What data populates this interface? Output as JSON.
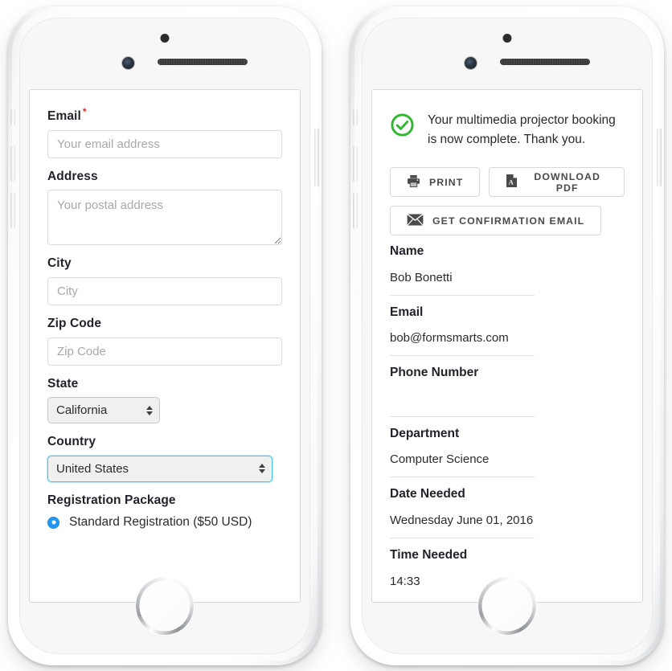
{
  "left_phone": {
    "device_label": "smartphone-mockup-left",
    "form": {
      "fields": [
        {
          "label": "Email",
          "required": true,
          "type": "text",
          "value": "",
          "placeholder": "Your email address"
        },
        {
          "label": "Address",
          "required": false,
          "type": "textarea",
          "value": "",
          "placeholder": "Your postal address"
        },
        {
          "label": "City",
          "required": false,
          "type": "text",
          "value": "",
          "placeholder": "City"
        },
        {
          "label": "Zip Code",
          "required": false,
          "type": "text",
          "value": "",
          "placeholder": "Zip Code"
        },
        {
          "label": "State",
          "required": false,
          "type": "select",
          "value": "California",
          "placeholder": ""
        },
        {
          "label": "Country",
          "required": false,
          "type": "select",
          "value": "United States",
          "placeholder": "",
          "focused": true
        }
      ],
      "radio_group": {
        "label": "Registration Package",
        "options": [
          {
            "label": "Standard Registration ($50 USD)",
            "selected": true
          }
        ]
      }
    }
  },
  "right_phone": {
    "device_label": "smartphone-mockup-right",
    "confirmation": {
      "message": "Your multimedia projector booking is now complete. Thank you.",
      "status_icon": "check-circle-icon",
      "actions": [
        {
          "label": "PRINT",
          "icon": "printer-icon"
        },
        {
          "label": "DOWNLOAD PDF",
          "icon": "pdf-file-icon"
        },
        {
          "label": "GET CONFIRMATION EMAIL",
          "icon": "envelope-icon"
        }
      ],
      "details": [
        {
          "label": "Name",
          "value": "Bob Bonetti"
        },
        {
          "label": "Email",
          "value": "bob@formsmarts.com"
        },
        {
          "label": "Phone Number",
          "value": ""
        },
        {
          "label": "Department",
          "value": "Computer Science"
        },
        {
          "label": "Date Needed",
          "value": "Wednesday June 01, 2016"
        },
        {
          "label": "Time Needed",
          "value": "14:33"
        }
      ]
    }
  },
  "colors": {
    "accent_blue": "#2196f3",
    "focus_cyan": "#4ec2e8",
    "success_green": "#2eb82e",
    "required_red": "#d0342c",
    "text_dark": "#20242a",
    "border_grey": "#dcdcdc"
  }
}
